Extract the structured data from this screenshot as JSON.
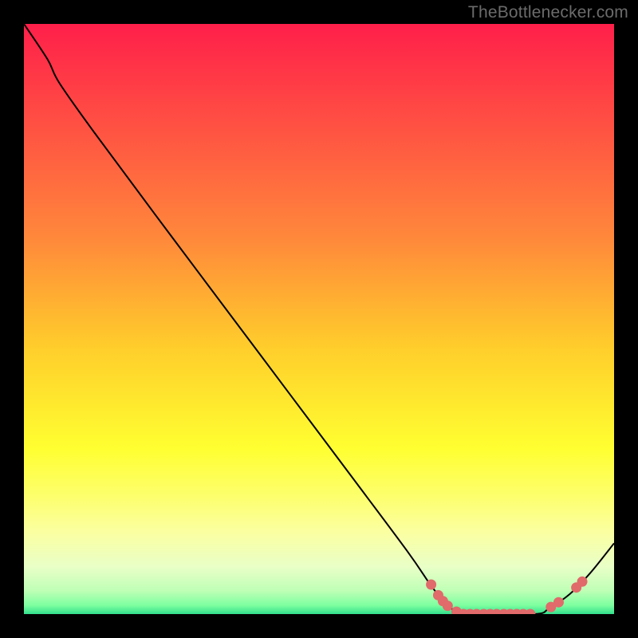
{
  "watermark": "TheBottlenecker.com",
  "chart_data": {
    "type": "line",
    "title": "",
    "xlabel": "",
    "ylabel": "",
    "xlim": [
      0,
      100
    ],
    "ylim": [
      0,
      100
    ],
    "gradient_stops": [
      {
        "offset": 0.0,
        "color": "#ff1f4a"
      },
      {
        "offset": 0.36,
        "color": "#ff873b"
      },
      {
        "offset": 0.55,
        "color": "#ffce2b"
      },
      {
        "offset": 0.72,
        "color": "#ffff31"
      },
      {
        "offset": 0.8,
        "color": "#fdff6c"
      },
      {
        "offset": 0.86,
        "color": "#fbffa0"
      },
      {
        "offset": 0.92,
        "color": "#e9ffc7"
      },
      {
        "offset": 0.96,
        "color": "#bfffb6"
      },
      {
        "offset": 0.985,
        "color": "#7effa0"
      },
      {
        "offset": 1.0,
        "color": "#33e08d"
      }
    ],
    "series": [
      {
        "name": "bottleneck-curve",
        "color": "#000000",
        "points": [
          {
            "x": 0.0,
            "y": 100.0
          },
          {
            "x": 4.0,
            "y": 94.0
          },
          {
            "x": 6.0,
            "y": 90.0
          },
          {
            "x": 12.0,
            "y": 81.5
          },
          {
            "x": 25.0,
            "y": 64.0
          },
          {
            "x": 40.0,
            "y": 44.0
          },
          {
            "x": 55.0,
            "y": 24.0
          },
          {
            "x": 65.0,
            "y": 10.6
          },
          {
            "x": 69.0,
            "y": 4.8
          },
          {
            "x": 71.5,
            "y": 1.8
          },
          {
            "x": 73.0,
            "y": 0.6
          },
          {
            "x": 75.0,
            "y": 0.0
          },
          {
            "x": 86.5,
            "y": 0.0
          },
          {
            "x": 89.0,
            "y": 1.0
          },
          {
            "x": 92.5,
            "y": 3.4
          },
          {
            "x": 96.0,
            "y": 7.0
          },
          {
            "x": 100.0,
            "y": 12.0
          }
        ]
      }
    ],
    "markers": {
      "color": "#e16a6a",
      "radius": 6.5,
      "points": [
        {
          "x": 69.0,
          "y": 5.0
        },
        {
          "x": 70.2,
          "y": 3.2
        },
        {
          "x": 71.0,
          "y": 2.2
        },
        {
          "x": 71.8,
          "y": 1.4
        },
        {
          "x": 73.3,
          "y": 0.4
        },
        {
          "x": 74.5,
          "y": 0.0
        },
        {
          "x": 75.6,
          "y": 0.0
        },
        {
          "x": 76.7,
          "y": 0.0
        },
        {
          "x": 77.9,
          "y": 0.0
        },
        {
          "x": 79.0,
          "y": 0.0
        },
        {
          "x": 80.1,
          "y": 0.0
        },
        {
          "x": 81.3,
          "y": 0.0
        },
        {
          "x": 82.4,
          "y": 0.0
        },
        {
          "x": 83.5,
          "y": 0.0
        },
        {
          "x": 84.6,
          "y": 0.0
        },
        {
          "x": 85.8,
          "y": 0.0
        },
        {
          "x": 89.3,
          "y": 1.2
        },
        {
          "x": 90.6,
          "y": 2.0
        },
        {
          "x": 93.6,
          "y": 4.5
        },
        {
          "x": 94.6,
          "y": 5.5
        }
      ]
    }
  }
}
